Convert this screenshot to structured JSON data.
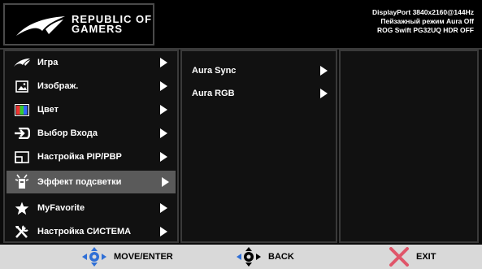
{
  "header": {
    "brand_line1": "REPUBLIC OF",
    "brand_line2": "GAMERS",
    "info": [
      "DisplayPort 3840x2160@144Hz",
      "Пейзажный режим Aura Off",
      "ROG Swift PG32UQ HDR OFF"
    ]
  },
  "menu": {
    "items": [
      {
        "label": "Игра",
        "icon": "rog-eye-icon"
      },
      {
        "label": "Изображ.",
        "icon": "image-icon"
      },
      {
        "label": "Цвет",
        "icon": "color-bars-icon"
      },
      {
        "label": "Выбор Входа",
        "icon": "input-arrow-icon"
      },
      {
        "label": "Настройка PIP/PBP",
        "icon": "pip-icon"
      },
      {
        "label": "Эффект подсветки",
        "icon": "lighting-effect-icon",
        "selected": true
      },
      {
        "label": "MyFavorite",
        "icon": "star-icon"
      },
      {
        "label": "Настройка СИСТЕМА",
        "icon": "tools-icon"
      }
    ]
  },
  "submenu": {
    "items": [
      {
        "label": "Aura Sync"
      },
      {
        "label": "Aura RGB"
      }
    ]
  },
  "footer": {
    "move_enter": "MOVE/ENTER",
    "back": "BACK",
    "exit": "EXIT"
  },
  "colors": {
    "accent_blue": "#2f6fd6",
    "exit_red": "#e0566a",
    "selected_bg": "#5a5a5a",
    "footer_bg": "#d9d9d9"
  }
}
